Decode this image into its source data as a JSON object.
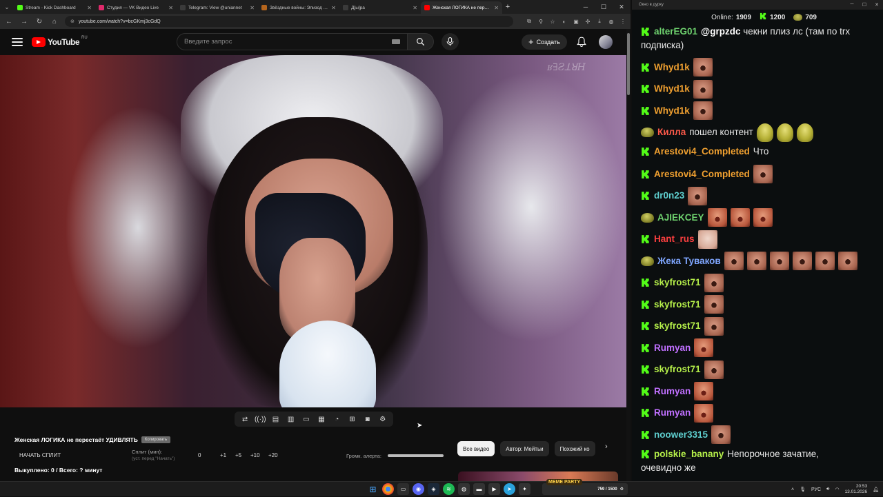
{
  "browser": {
    "tabs": [
      {
        "label": "Stream - Kick Dashboard",
        "color": "#53fc18",
        "active": false
      },
      {
        "label": "Студия — VK Видео Live",
        "color": "#e02a6b",
        "active": false
      },
      {
        "label": "Telegram: View @uniannet",
        "color": "#3a3a3a",
        "active": false
      },
      {
        "label": "Звёздные войны: Эпизод 5 –",
        "color": "#b5651d",
        "active": false
      },
      {
        "label": "Д[ы]ра",
        "color": "#3a3a3a",
        "active": false
      },
      {
        "label": "Женская ЛОГИКА не перест",
        "color": "#ff0000",
        "active": true
      }
    ],
    "url": "youtube.com/watch?v=bcGKmj3cGdQ"
  },
  "youtube": {
    "logo_word": "YouTube",
    "region": "RU",
    "search_placeholder": "Введите запрос",
    "create_label": "Создать"
  },
  "video": {
    "watermark": "ʁ∃ƧꓕꓤH"
  },
  "under_video": {
    "title": "Женская ЛОГИКА не перестаёт УДИВЛЯТЬ",
    "copy_chip": "Копировать",
    "split_button": "НАЧАТЬ СПЛИТ",
    "split_label": "Сплит (мин):",
    "split_hint": "(уст. перед \"Начать\")",
    "split_value": "0",
    "split_increments": [
      "+1",
      "+5",
      "+10",
      "+20"
    ],
    "alert_volume_label": "Громк. алерта:",
    "alert_volume": 1.0,
    "bought": "Выкуплено: 0 / Всего: ? минут",
    "chips": [
      "Все видео",
      "Автор: Мейтьи",
      "Похожий ко"
    ]
  },
  "chat": {
    "window_title": "Окно в дурку",
    "online_label": "Online:",
    "online_count": "1909",
    "kick_count": "1200",
    "pepe_count": "709",
    "messages": [
      {
        "badge": "kick",
        "user": "alterEG01",
        "color": "#6fd36f",
        "text": "@grpzdc чекни плиз лс (там по trx",
        "wrap": "подписка)",
        "mention": "@grpzdc"
      },
      {
        "badge": "kick",
        "user": "Whyd1k",
        "color": "#f0a030",
        "text": "",
        "emotes": [
          "em-face"
        ]
      },
      {
        "badge": "kick",
        "user": "Whyd1k",
        "color": "#f0a030",
        "text": "",
        "emotes": [
          "em-face"
        ]
      },
      {
        "badge": "kick",
        "user": "Whyd1k",
        "color": "#f0a030",
        "text": "",
        "emotes": [
          "em-face"
        ]
      },
      {
        "badge": "pepe",
        "user": "Килла",
        "color": "#ff5a4a",
        "text": "пошел контент",
        "emotes": [
          "em-pepe",
          "em-pepe",
          "em-pepe"
        ]
      },
      {
        "badge": "kick",
        "user": "Arestovi4_Completed",
        "color": "#f0a030",
        "text": "Что"
      },
      {
        "badge": "kick",
        "user": "Arestovi4_Completed",
        "color": "#f0a030",
        "text": "",
        "emotes": [
          "em-face"
        ]
      },
      {
        "badge": "kick",
        "user": "dr0n23",
        "color": "#5fd0d0",
        "text": "",
        "emotes": [
          "em-face"
        ]
      },
      {
        "badge": "pepe",
        "user": "AJIEKCEY",
        "color": "#6fd36f",
        "text": "",
        "emotes": [
          "em-face2",
          "em-face2",
          "em-face2"
        ]
      },
      {
        "badge": "kick",
        "user": "Hant_rus",
        "color": "#ff4040",
        "text": "",
        "emotes": [
          "em-pale"
        ]
      },
      {
        "badge": "pepe",
        "user": "Жека Туваков",
        "color": "#7fa6ff",
        "text": "",
        "emotes": [
          "em-face",
          "em-face",
          "em-face",
          "em-face",
          "em-face",
          "em-face"
        ]
      },
      {
        "badge": "kick",
        "user": "skyfrost71",
        "color": "#b6f04a",
        "text": "",
        "emotes": [
          "em-face"
        ]
      },
      {
        "badge": "kick",
        "user": "skyfrost71",
        "color": "#b6f04a",
        "text": "",
        "emotes": [
          "em-face"
        ]
      },
      {
        "badge": "kick",
        "user": "skyfrost71",
        "color": "#b6f04a",
        "text": "",
        "emotes": [
          "em-face"
        ]
      },
      {
        "badge": "kick",
        "user": "Rumyan",
        "color": "#c070ff",
        "text": "",
        "emotes": [
          "em-face2"
        ]
      },
      {
        "badge": "kick",
        "user": "skyfrost71",
        "color": "#b6f04a",
        "text": "",
        "emotes": [
          "em-face"
        ]
      },
      {
        "badge": "kick",
        "user": "Rumyan",
        "color": "#c070ff",
        "text": "",
        "emotes": [
          "em-face2"
        ]
      },
      {
        "badge": "kick",
        "user": "Rumyan",
        "color": "#c070ff",
        "text": "",
        "emotes": [
          "em-face2"
        ]
      },
      {
        "badge": "kick",
        "user": "noower3315",
        "color": "#5fd0d0",
        "text": "",
        "emotes": [
          "em-face"
        ]
      },
      {
        "badge": "kick",
        "user": "polskie_banany",
        "color": "#b6f04a",
        "text": "Непорочное зачатие,",
        "wrap": "очевидно же"
      }
    ]
  },
  "taskbar": {
    "widget_text": "759 / 1500",
    "widget_party": "MEME PARTY",
    "lang": "РУС",
    "time": "20:53",
    "date": "13.01.2026"
  },
  "colors": {
    "kick_green": "#53fc18",
    "youtube_red": "#ff0000"
  }
}
